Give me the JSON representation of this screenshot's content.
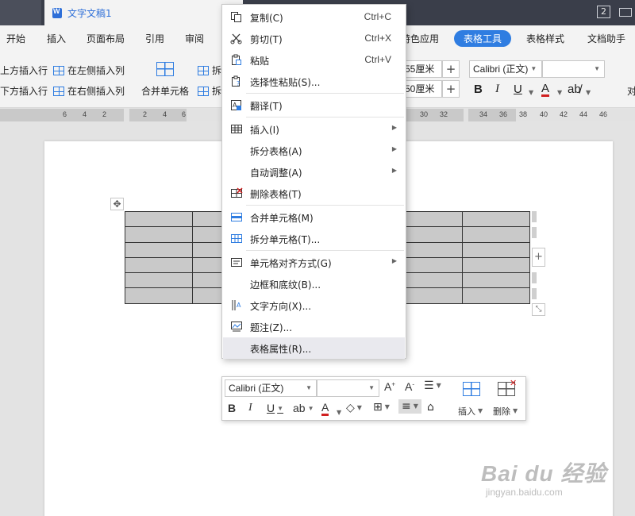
{
  "window": {
    "doc_title": "文字文稿1",
    "tab_count": "2"
  },
  "ribbon_tabs": [
    "开始",
    "插入",
    "页面布局",
    "引用",
    "审阅",
    "特色应用",
    "表格工具",
    "表格样式",
    "文档助手"
  ],
  "ribbon": {
    "insert_above": "上方插入行",
    "insert_below": "下方插入行",
    "insert_left": "在左侧插入列",
    "insert_right": "在右侧插入列",
    "merge_cells": "合并单元格",
    "split1": "拆",
    "split2": "拆",
    "height_value": "55厘米",
    "width_value": "50厘米",
    "font_name": "Calibri (正文)",
    "font_size": "",
    "align_more": "对"
  },
  "ruler_numbers": [
    "6",
    "4",
    "2",
    "2",
    "4",
    "6",
    "30",
    "32",
    "34",
    "36",
    "38",
    "40",
    "42",
    "44",
    "46"
  ],
  "context_menu": {
    "items": [
      {
        "icon": "copy-icon",
        "label": "复制(C)",
        "shortcut": "Ctrl+C"
      },
      {
        "icon": "scissors-icon",
        "label": "剪切(T)",
        "shortcut": "Ctrl+X"
      },
      {
        "icon": "paste-icon",
        "label": "粘贴",
        "shortcut": "Ctrl+V"
      },
      {
        "icon": "paste-special-icon",
        "label": "选择性粘贴(S)...",
        "shortcut": ""
      },
      {
        "icon": "translate-icon",
        "label": "翻译(T)",
        "shortcut": ""
      },
      {
        "icon": "table-insert-icon",
        "label": "插入(I)",
        "shortcut": ""
      },
      {
        "icon": "",
        "label": "拆分表格(A)",
        "shortcut": ""
      },
      {
        "icon": "",
        "label": "自动调整(A)",
        "shortcut": ""
      },
      {
        "icon": "delete-table-icon",
        "label": "删除表格(T)",
        "shortcut": ""
      },
      {
        "icon": "merge-cells-icon",
        "label": "合并单元格(M)",
        "shortcut": ""
      },
      {
        "icon": "split-cells-icon",
        "label": "拆分单元格(T)...",
        "shortcut": ""
      },
      {
        "icon": "cell-align-icon",
        "label": "单元格对齐方式(G)",
        "shortcut": ""
      },
      {
        "icon": "",
        "label": "边框和底纹(B)...",
        "shortcut": ""
      },
      {
        "icon": "text-direction-icon",
        "label": "文字方向(X)...",
        "shortcut": ""
      },
      {
        "icon": "caption-icon",
        "label": "题注(Z)...",
        "shortcut": ""
      },
      {
        "icon": "",
        "label": "表格属性(R)...",
        "shortcut": ""
      }
    ]
  },
  "mini_toolbar": {
    "font_name": "Calibri (正文)",
    "font_size": "",
    "insert_label": "插入",
    "delete_label": "删除"
  },
  "watermark": {
    "brand": "Bai du 经验",
    "url": "jingyan.baidu.com"
  },
  "colors": {
    "accent": "#2f7de1",
    "title_bar": "#3a3e4a",
    "cell_fill": "#c9c9c9"
  }
}
